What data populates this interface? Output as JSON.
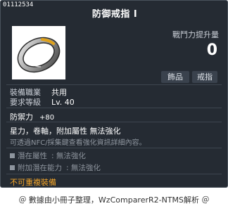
{
  "tooltip": {
    "item_id": "01112534",
    "title": "防御戒指 I",
    "combat_power_label": "戰鬥力提升量",
    "combat_power_value": "0",
    "tags": [
      "飾品",
      "戒指"
    ],
    "requirements": [
      {
        "label": "裝備職業",
        "value": "共用"
      },
      {
        "label": "要求等級",
        "value": "Lv. 40"
      }
    ],
    "stat": {
      "label": "防禦力",
      "value": "+80"
    },
    "description_line1": "星力，卷軸，附加屬性 無法強化",
    "description_line2": "可透過NFC/採集鍵查看強化資訊詳細內容。",
    "potentials": [
      {
        "label": "潛在屬性",
        "value": ": 無法強化"
      },
      {
        "label": "附加潛在能力",
        "value": ": 無法強化"
      }
    ],
    "warning": "不可重複裝備"
  },
  "footer": {
    "text": "＠ 數據由小冊子整理，WzComparerR2-NTMS解析 ＠"
  },
  "colors": {
    "tooltip_bg": "#252b33",
    "warning": "#f3a529",
    "muted": "#8e959e"
  },
  "icons": {
    "item": "ring-icon",
    "bullet": "square-bullet-icon"
  }
}
